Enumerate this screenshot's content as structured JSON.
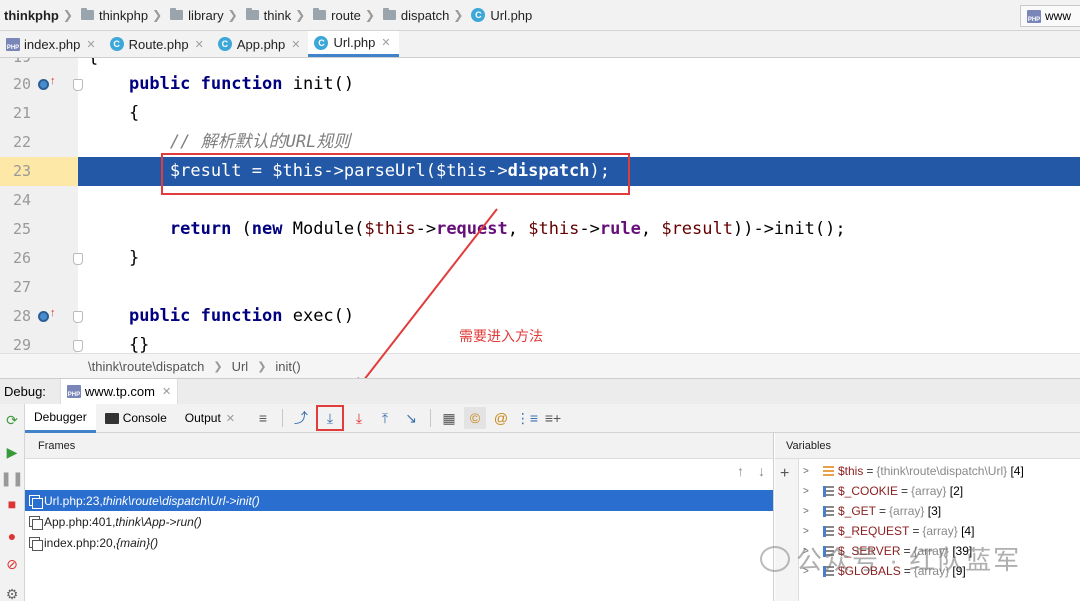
{
  "breadcrumb": {
    "items": [
      "thinkphp",
      "thinkphp",
      "library",
      "think",
      "route",
      "dispatch",
      "Url.php"
    ],
    "run_config_label": "www"
  },
  "tabs": [
    {
      "label": "index.php",
      "icon": "php-file-icon"
    },
    {
      "label": "Route.php",
      "icon": "class-icon"
    },
    {
      "label": "App.php",
      "icon": "class-icon"
    },
    {
      "label": "Url.php",
      "icon": "class-icon",
      "active": true
    }
  ],
  "editor": {
    "current_line": 23,
    "lines": [
      {
        "num": "19",
        "code": "{"
      },
      {
        "num": "20",
        "code": "    public function init()"
      },
      {
        "num": "21",
        "code": "    {"
      },
      {
        "num": "22",
        "code": "        // 解析默认的URL规则"
      },
      {
        "num": "23",
        "code": "        $result = $this->parseUrl($this->dispatch);"
      },
      {
        "num": "24",
        "code": ""
      },
      {
        "num": "25",
        "code": "        return (new Module($this->request, $this->rule, $result))->init();"
      },
      {
        "num": "26",
        "code": "    }"
      },
      {
        "num": "27",
        "code": ""
      },
      {
        "num": "28",
        "code": "    public function exec()"
      },
      {
        "num": "29",
        "code": "    {}"
      }
    ]
  },
  "status_path": {
    "namespace": "\\think\\route\\dispatch",
    "class": "Url",
    "method": "init()"
  },
  "annotation": {
    "text": "需要进入方法",
    "color": "#e23b3b"
  },
  "debug": {
    "label": "Debug:",
    "session": "www.tp.com",
    "tabs": {
      "debugger": "Debugger",
      "console": "Console",
      "output": "Output"
    },
    "toolbar_icons": [
      "show-execution-point-icon",
      "step-over-icon",
      "step-into-icon",
      "force-step-into-icon",
      "step-out-icon",
      "run-to-cursor-icon",
      "evaluate-expression-icon",
      "coverage-icon",
      "watch-icon",
      "frames-icon",
      "settings-icon"
    ],
    "frames_header": "Frames",
    "frames": [
      {
        "loc": "Url.php:23, ",
        "fn": "think\\route\\dispatch\\Url->init()",
        "selected": true
      },
      {
        "loc": "App.php:401, ",
        "fn": "think\\App->run()"
      },
      {
        "loc": "index.php:20, ",
        "fn": "{main}()"
      }
    ],
    "variables_header": "Variables",
    "variables": [
      {
        "name": "$this",
        "type": "{think\\route\\dispatch\\Url}",
        "count": "[4]",
        "icon": "object"
      },
      {
        "name": "$_COOKIE",
        "type": "{array}",
        "count": "[2]",
        "icon": "array"
      },
      {
        "name": "$_GET",
        "type": "{array}",
        "count": "[3]",
        "icon": "array"
      },
      {
        "name": "$_REQUEST",
        "type": "{array}",
        "count": "[4]",
        "icon": "array"
      },
      {
        "name": "$_SERVER",
        "type": "{array}",
        "count": "[39]",
        "icon": "array"
      },
      {
        "name": "$GLOBALS",
        "type": "{array}",
        "count": "[9]",
        "icon": "array"
      }
    ]
  },
  "watermark": "公众号 · 红队蓝军"
}
